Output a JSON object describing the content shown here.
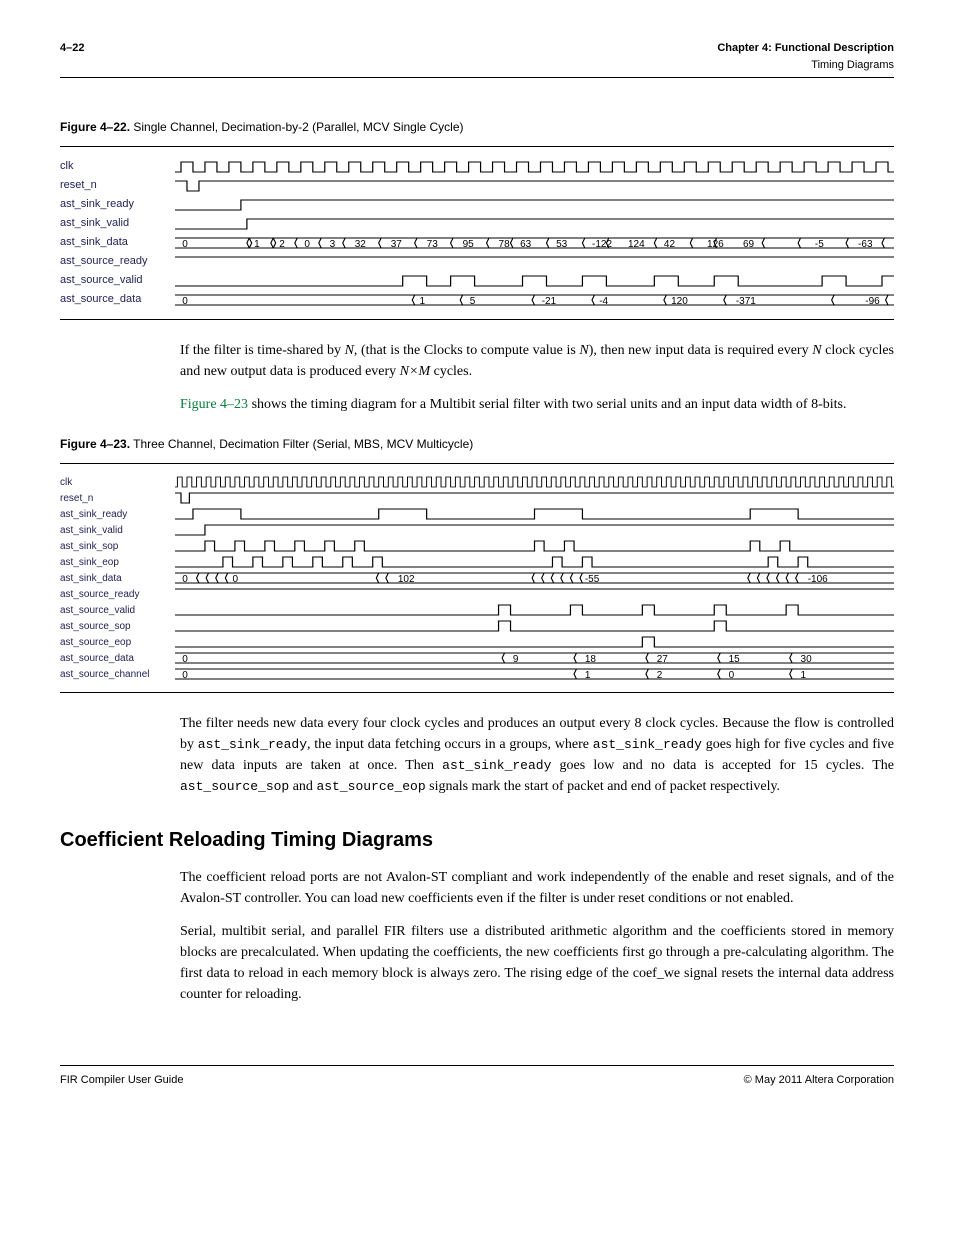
{
  "header": {
    "page": "4–22",
    "chapter": "Chapter 4: Functional Description",
    "section": "Timing Diagrams"
  },
  "fig22": {
    "label": "Figure 4–22.",
    "caption": "Single Channel, Decimation-by-2 (Parallel, MCV Single Cycle)",
    "signals": [
      "clk",
      "reset_n",
      "ast_sink_ready",
      "ast_sink_valid",
      "ast_sink_data",
      "ast_source_ready",
      "ast_source_valid",
      "ast_source_data"
    ],
    "sink_data": [
      "0",
      "1",
      "2",
      "0",
      "3",
      "32",
      "37",
      "73",
      "95",
      "78",
      "63",
      "53",
      "-122",
      "124",
      "42",
      "126",
      "69",
      "-5",
      "-63"
    ],
    "source_data": [
      "0",
      "1",
      "5",
      "-21",
      "-4",
      "120",
      "-371",
      "-96"
    ]
  },
  "paras": {
    "p1a": "If the filter is time-shared by ",
    "p1b": ", (that is the Clocks to compute value is ",
    "p1c": "), then new input data is required every ",
    "p1d": " clock cycles and new output data is produced every ",
    "p1e": " cycles.",
    "N": "N",
    "NM": "N×M",
    "p2a": " shows the timing diagram for a Multibit serial filter with two serial units and an input data width of 8-bits.",
    "link23": "Figure 4–23"
  },
  "fig23": {
    "label": "Figure 4–23.",
    "caption": "Three Channel, Decimation Filter (Serial, MBS, MCV Multicycle)",
    "signals": [
      "clk",
      "reset_n",
      "ast_sink_ready",
      "ast_sink_valid",
      "ast_sink_sop",
      "ast_sink_eop",
      "ast_sink_data",
      "ast_source_ready",
      "ast_source_valid",
      "ast_source_sop",
      "ast_source_eop",
      "ast_source_data",
      "ast_source_channel"
    ],
    "sink_data": [
      "0",
      "0",
      "102",
      "-55",
      "-106"
    ],
    "source_data": [
      "0",
      "9",
      "18",
      "27",
      "15",
      "30"
    ],
    "source_channel": [
      "0",
      "1",
      "2",
      "0",
      "1"
    ]
  },
  "paras2": {
    "p3": "The filter needs new data every four clock cycles and produces an output every 8 clock cycles. Because the flow is controlled by ",
    "p3b": ", the input data fetching occurs in a groups, where ",
    "p3c": " goes high for five cycles and five new data inputs are taken at once. Then ",
    "p3d": " goes low and no data is accepted for 15 cycles. The ",
    "p3e": " and ",
    "p3f": " signals mark the start of packet and end of packet respectively."
  },
  "section": {
    "title": "Coefficient Reloading Timing Diagrams",
    "p1": "The coefficient reload ports are not Avalon-ST compliant and work independently of the enable and reset signals, and of the Avalon-ST controller. You can load new coefficients even if the filter is under reset conditions or not enabled.",
    "p2": "Serial, multibit serial, and parallel FIR filters use a distributed arithmetic algorithm and the coefficients stored in memory blocks are precalculated. When updating the coefficients, the new coefficients first go through a pre-calculating algorithm. The first data to reload in each memory block is always zero. The rising edge of the coef_we signal resets the internal data address counter for reloading."
  },
  "footer": {
    "left": "FIR Compiler User Guide",
    "right": "© May 2011   Altera Corporation"
  },
  "chart_data": [
    {
      "type": "table",
      "title": "Figure 4–22 ast_sink_data sequence",
      "values": [
        "0",
        "1",
        "2",
        "0",
        "3",
        "32",
        "37",
        "73",
        "95",
        "78",
        "63",
        "53",
        "-122",
        "124",
        "42",
        "126",
        "69",
        "-5",
        "-63"
      ]
    },
    {
      "type": "table",
      "title": "Figure 4–22 ast_source_data sequence",
      "values": [
        "0",
        "1",
        "5",
        "-21",
        "-4",
        "120",
        "-371",
        "-96"
      ]
    },
    {
      "type": "table",
      "title": "Figure 4–23 ast_sink_data visible values",
      "values": [
        "0",
        "0",
        "102",
        "-55",
        "-106"
      ]
    },
    {
      "type": "table",
      "title": "Figure 4–23 ast_source_data sequence",
      "values": [
        "0",
        "9",
        "18",
        "27",
        "15",
        "30"
      ]
    },
    {
      "type": "table",
      "title": "Figure 4–23 ast_source_channel sequence",
      "values": [
        "0",
        "1",
        "2",
        "0",
        "1"
      ]
    }
  ]
}
